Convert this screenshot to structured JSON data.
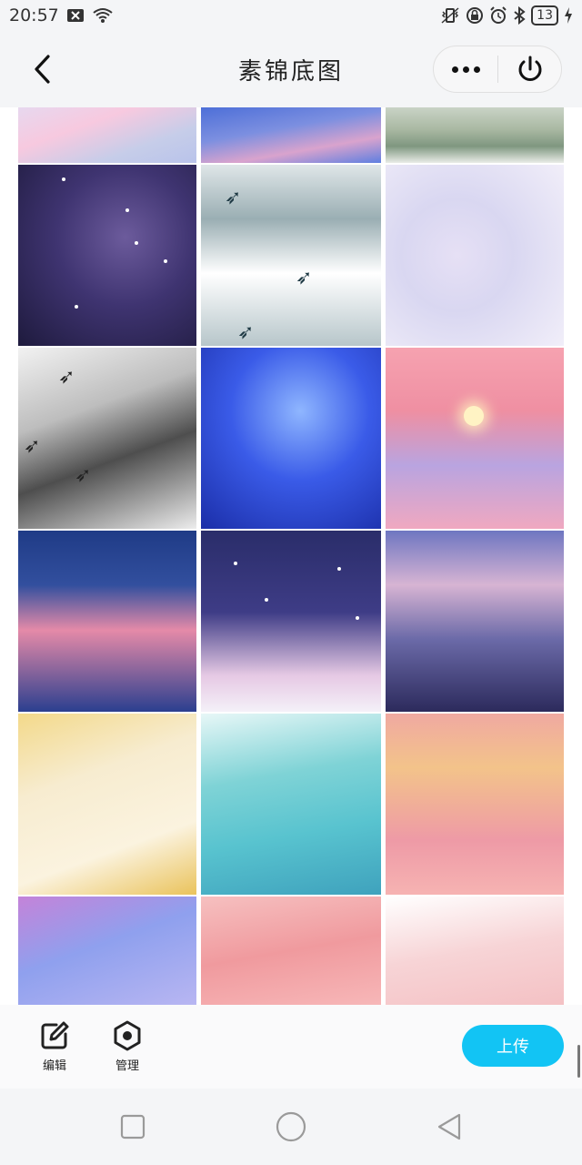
{
  "status_bar": {
    "time": "20:57",
    "battery": "13",
    "icons": [
      "close-box-icon",
      "wifi-icon",
      "vibrate-icon",
      "lock-icon",
      "alarm-icon",
      "bluetooth-icon",
      "battery-icon",
      "charging-icon"
    ]
  },
  "header": {
    "title": "素锦底图",
    "back_icon": "chevron-left-icon",
    "more_icon": "more-dots-icon",
    "close_icon": "power-icon"
  },
  "grid": {
    "rows": 6,
    "columns": 3
  },
  "toolbar": {
    "edit_label": "编辑",
    "manage_label": "管理",
    "upload_label": "上传",
    "accent_color": "#12c4f4"
  },
  "nav_bar": {
    "icons": [
      "recents-square-icon",
      "home-circle-icon",
      "back-triangle-icon"
    ]
  }
}
